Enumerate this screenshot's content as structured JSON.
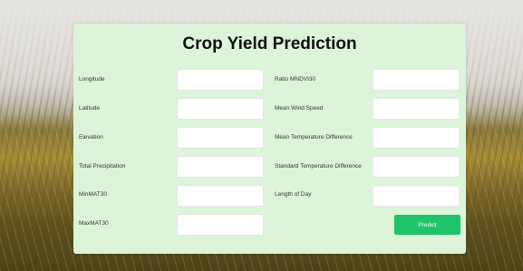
{
  "page": {
    "title": "Crop Yield Prediction",
    "accent_color": "#1fc46a",
    "card_color": "#dcf5da"
  },
  "form": {
    "left_fields": [
      {
        "label": "Longitude",
        "value": ""
      },
      {
        "label": "Latitude",
        "value": ""
      },
      {
        "label": "Elevation",
        "value": ""
      },
      {
        "label": "Total Precipitation",
        "value": ""
      },
      {
        "label": "MinMAT30",
        "value": ""
      },
      {
        "label": "MaxMAT30",
        "value": ""
      }
    ],
    "right_fields": [
      {
        "label": "Ratio MNDVI30",
        "value": ""
      },
      {
        "label": "Mean Wind Speed",
        "value": ""
      },
      {
        "label": "Mean Temperature Difference",
        "value": ""
      },
      {
        "label": "Standard Temperature Difference",
        "value": ""
      },
      {
        "label": "Length of Day",
        "value": ""
      }
    ],
    "submit_label": "Predict"
  }
}
